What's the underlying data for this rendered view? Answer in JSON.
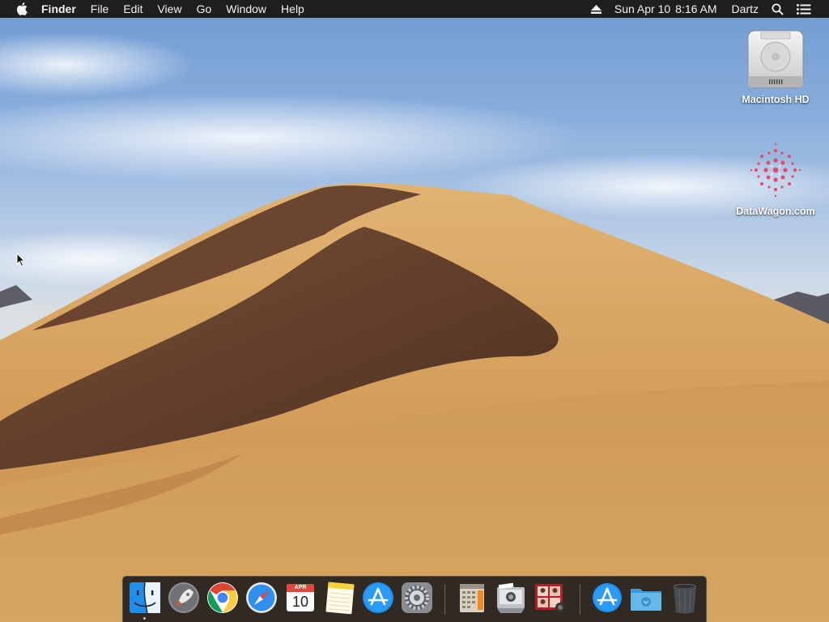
{
  "menubar": {
    "app_name": "Finder",
    "menus": [
      "File",
      "Edit",
      "View",
      "Go",
      "Window",
      "Help"
    ],
    "status": {
      "date": "Sun Apr 10",
      "time": "8:16 AM",
      "user": "Dartz"
    }
  },
  "desktop_icons": [
    {
      "label": "Macintosh HD",
      "icon": "hard-drive-icon"
    },
    {
      "label": "DataWagon.com",
      "icon": "datawagon-icon"
    }
  ],
  "dock": {
    "calendar_month": "APR",
    "calendar_day": "10",
    "apps": [
      "finder-icon",
      "launchpad-icon",
      "chrome-icon",
      "safari-icon",
      "calendar-icon",
      "notes-icon",
      "app-store-icon",
      "system-preferences-icon",
      "archive-icon",
      "image-capture-icon",
      "photo-booth-icon",
      "applications-stack-icon",
      "downloads-folder-icon",
      "trash-icon"
    ]
  },
  "colors": {
    "menubar": "#1e1e1e",
    "dock": "#191919",
    "sky": "#88addc",
    "sand": "#d9a35c"
  }
}
